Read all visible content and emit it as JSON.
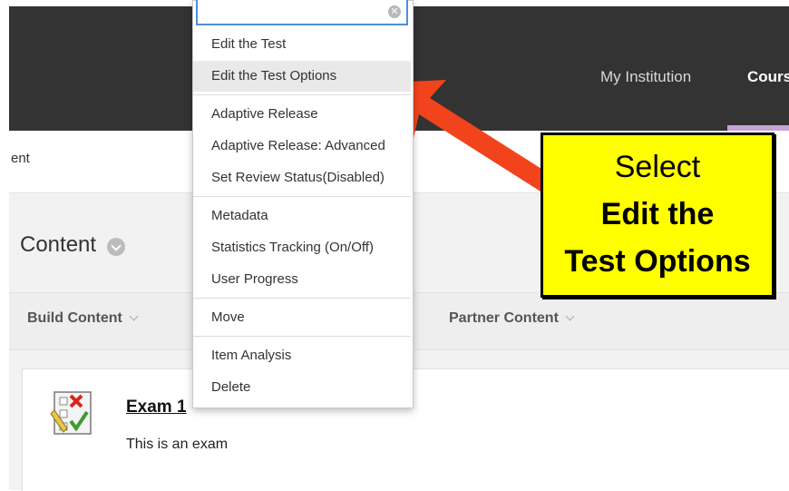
{
  "header": {
    "nav": [
      "My Institution",
      "Courses"
    ]
  },
  "breadcrumb": {
    "text": "ent"
  },
  "page": {
    "title": "Content",
    "actions": [
      "Build Content",
      "Partner Content"
    ]
  },
  "item": {
    "title": "Exam 1",
    "description": "This is an exam",
    "icon": "test-icon"
  },
  "menu": {
    "clear_glyph": "✕",
    "items": [
      "Edit the Test",
      "Edit the Test Options",
      "Adaptive Release",
      "Adaptive Release: Advanced",
      "Set Review Status(Disabled)",
      "Metadata",
      "Statistics Tracking (On/Off)",
      "User Progress",
      "Move",
      "Item Analysis",
      "Delete"
    ],
    "highlighted_index": 1
  },
  "callout": {
    "line1": "Select",
    "line2": "Edit the",
    "line3": "Test Options",
    "background": "#ffff00"
  },
  "colors": {
    "header_bg": "#333333",
    "arrow": "#f2431d",
    "focus_border": "#4a90d9"
  }
}
